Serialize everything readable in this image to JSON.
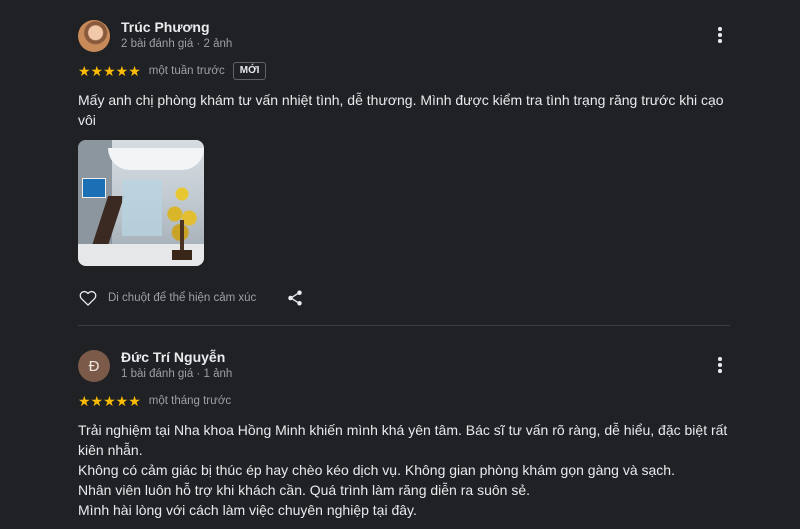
{
  "reviews": [
    {
      "author": "Trúc Phương",
      "meta": "2 bài đánh giá · 2 ảnh",
      "stars": "★★★★★",
      "rating": 5,
      "time": "một tuần trước",
      "badge": "MỚI",
      "text": [
        "Mấy anh chị phòng khám tư vấn nhiệt tình, dễ thương. Mình được kiểm tra tình trạng răng trước khi cạo vôi"
      ],
      "like_label": "Di chuột để thể hiện cảm xúc"
    },
    {
      "author": "Đức Trí Nguyễn",
      "avatar_letter": "Đ",
      "meta": "1 bài đánh giá · 1 ảnh",
      "stars": "★★★★★",
      "rating": 5,
      "time": "một tháng trước",
      "text": [
        "Trải nghiệm tại Nha khoa Hồng Minh khiến mình khá yên tâm. Bác sĩ tư vấn rõ ràng, dễ hiểu, đặc biệt rất kiên nhẫn.",
        "Không có cảm giác bị thúc ép hay chèo kéo dịch vụ. Không gian phòng khám gọn gàng và sạch.",
        "Nhân viên luôn hỗ trợ khi khách cần. Quá trình làm răng diễn ra suôn sẻ.",
        "Mình hài lòng với cách làm việc chuyên nghiệp tại đây."
      ]
    }
  ],
  "colors": {
    "background": "#202124",
    "star": "#fbbc04",
    "text": "#e8eaed",
    "muted": "#9aa0a6"
  },
  "icons": [
    "more-vert-icon",
    "heart-icon",
    "share-icon",
    "star-icon"
  ]
}
